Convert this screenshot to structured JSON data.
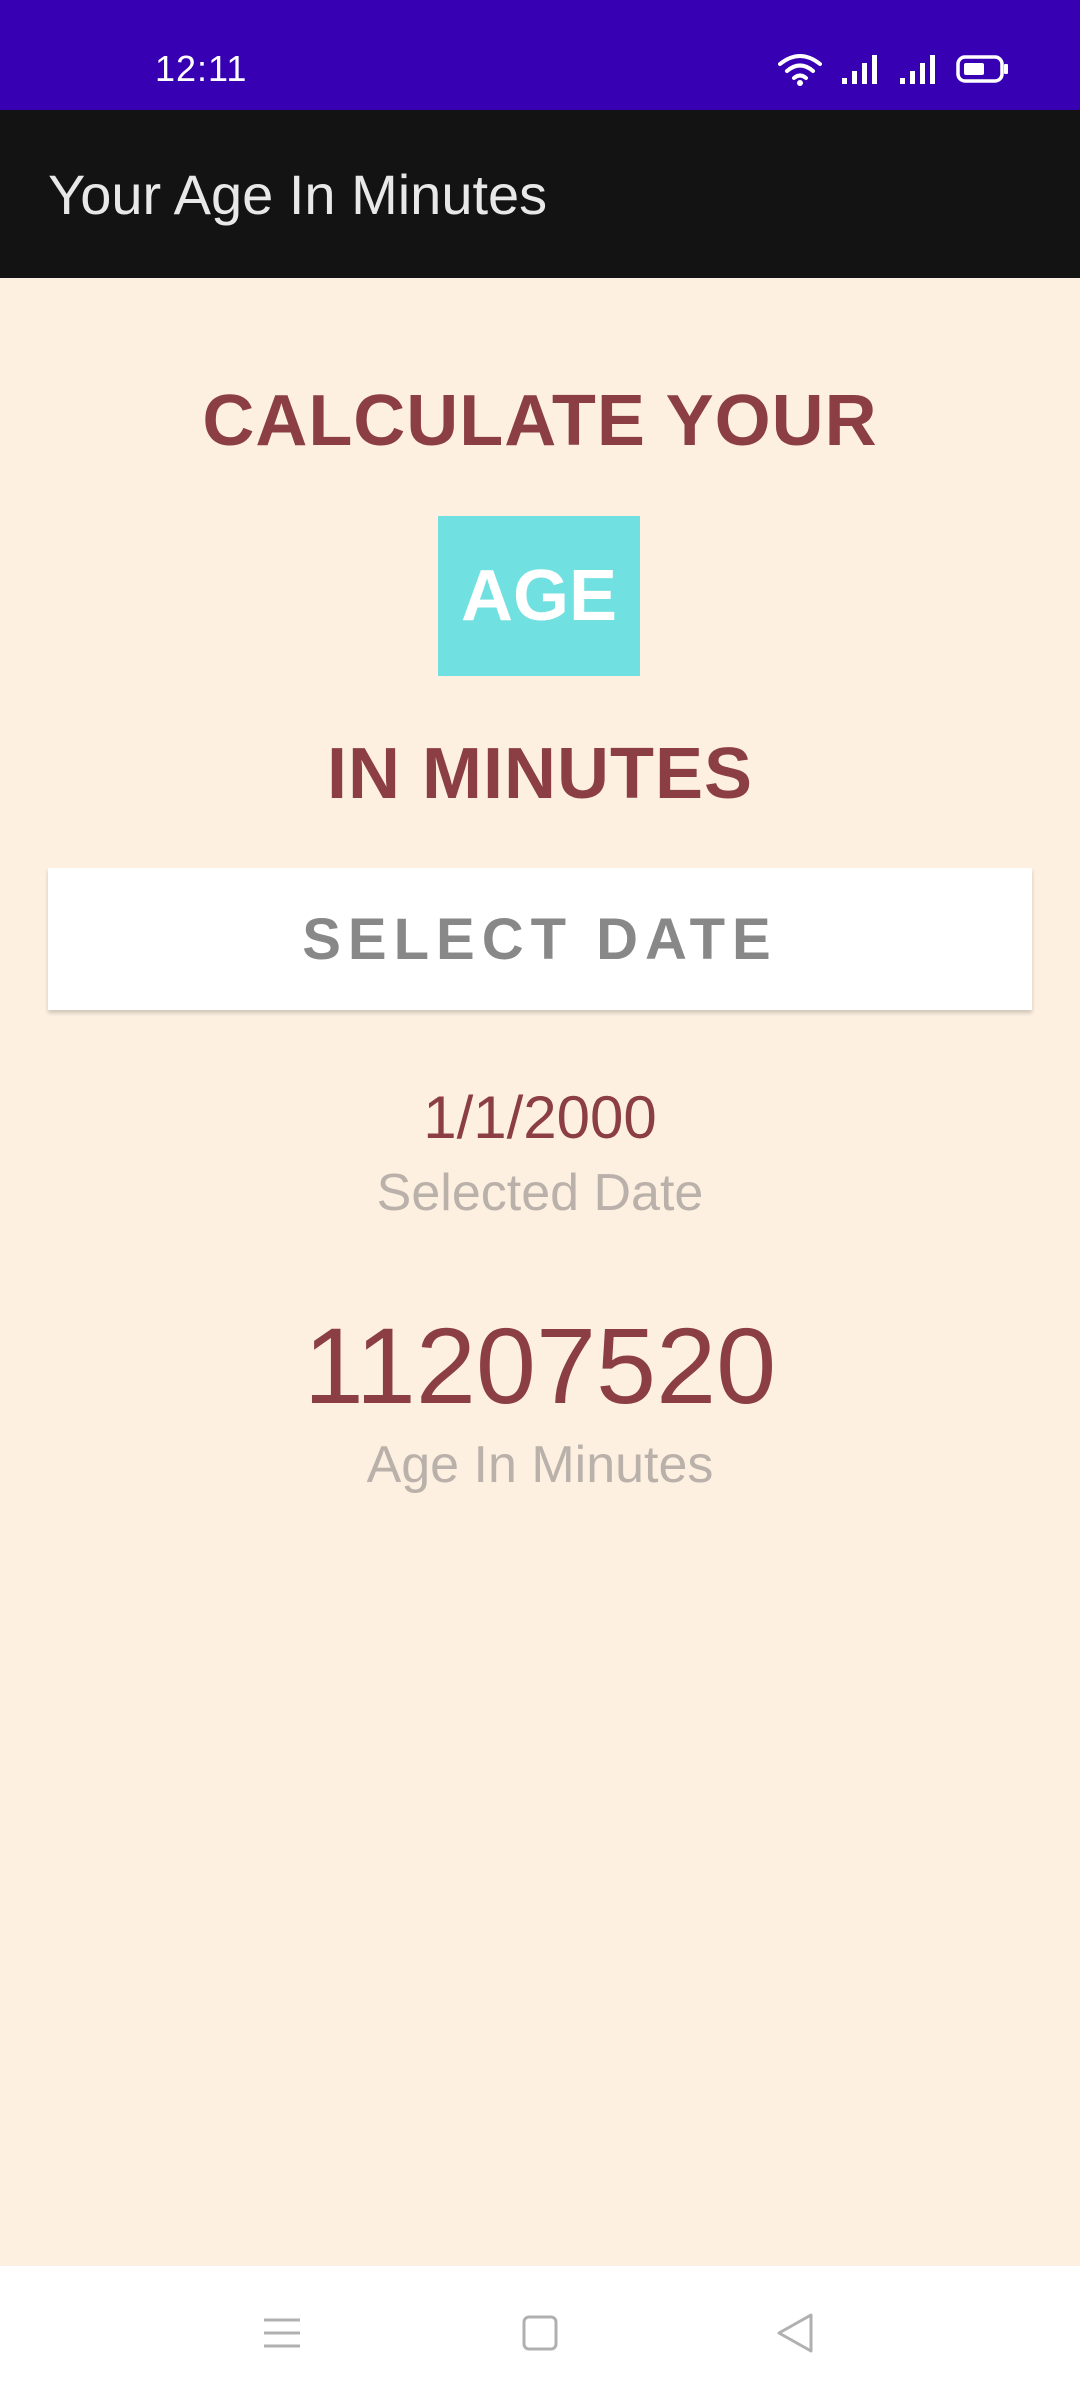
{
  "status_bar": {
    "time": "12:11",
    "icons": [
      "wifi-icon",
      "signal-icon",
      "signal-icon",
      "battery-icon"
    ],
    "background": "#3700b3"
  },
  "app_bar": {
    "title": "Your Age In Minutes",
    "background": "#131313"
  },
  "main": {
    "heading_line1": "CALCULATE YOUR",
    "heading_highlight": "AGE",
    "heading_line3": "IN MINUTES",
    "select_date_button": "SELECT DATE",
    "selected_date_value": "1/1/2000",
    "selected_date_caption": "Selected Date",
    "age_in_minutes_value": "11207520",
    "age_in_minutes_caption": "Age In Minutes"
  },
  "colors": {
    "background": "#fdf0e1",
    "heading": "#8b3e44",
    "highlight_box": "#71e0e0",
    "caption": "#b9b1aa"
  },
  "nav_bar": {
    "buttons": [
      "menu-icon",
      "home-icon",
      "back-icon"
    ]
  }
}
